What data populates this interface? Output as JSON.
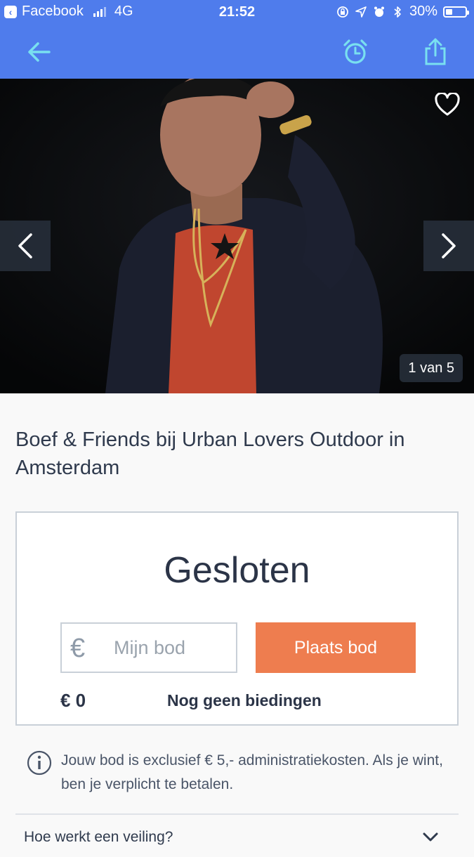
{
  "status_bar": {
    "back_app": "Facebook",
    "network": "4G",
    "time": "21:52",
    "battery": "30%"
  },
  "nav": {
    "back_icon": "arrow-left-icon",
    "alarm_icon": "alarm-clock-icon",
    "share_icon": "share-icon",
    "accent_color": "#79e0f0"
  },
  "gallery": {
    "counter": "1 van 5",
    "heart_icon": "heart-icon"
  },
  "event": {
    "title": "Boef & Friends bij Urban Lovers Outdoor in Amsterdam"
  },
  "auction": {
    "status": "Gesloten",
    "currency_symbol": "€",
    "bid_placeholder": "Mijn bod",
    "place_bid_label": "Plaats bod",
    "current_amount": "€ 0",
    "bids_text": "Nog geen biedingen",
    "button_color": "#ee7d4f"
  },
  "info": {
    "text": "Jouw bod is exclusief € 5,- administratiekosten. Als je wint, ben je verplicht te betalen."
  },
  "faq": {
    "label": "Hoe werkt een veiling?"
  },
  "colors": {
    "brand": "#4f7cec",
    "text": "#2f3a4d"
  }
}
